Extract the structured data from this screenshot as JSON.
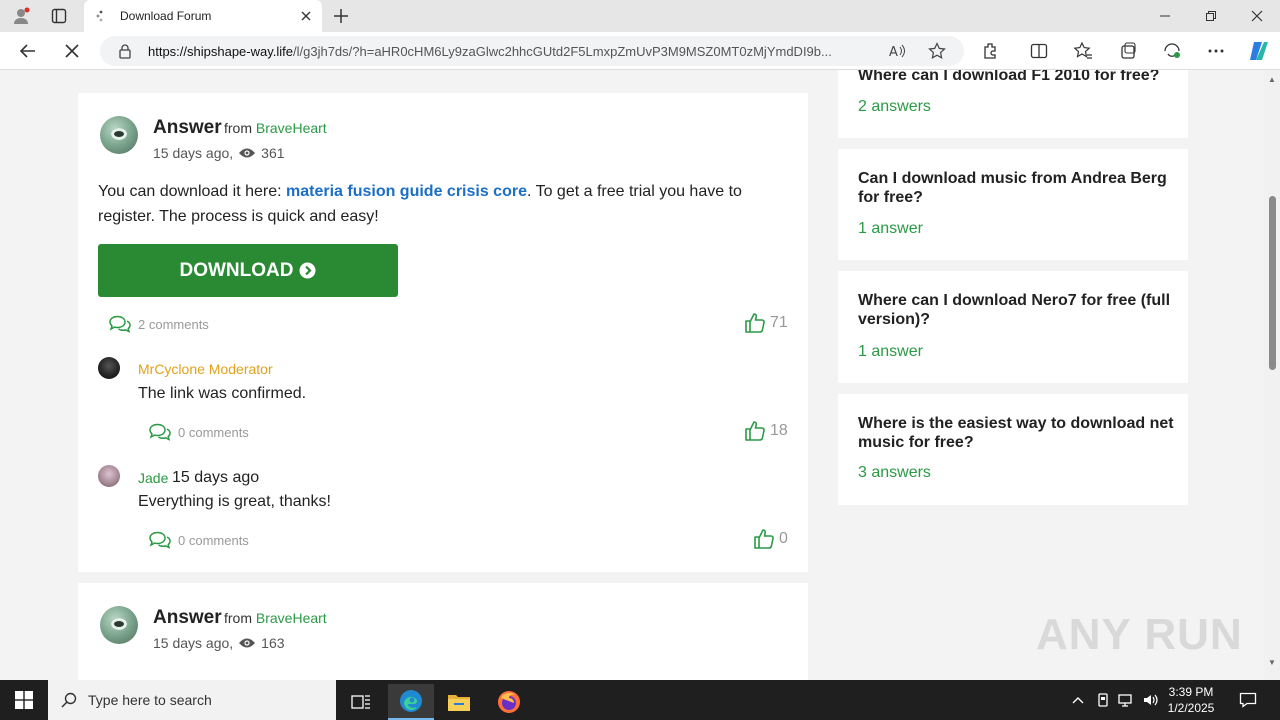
{
  "browser": {
    "tab_title": "Download Forum",
    "url_host": "https://shipshape-way.life",
    "url_path": "/l/g3jh7ds/?h=aHR0cHM6Ly9zaGlwc2hhcGUtd2F5LmxpZmUvP3M9MSZ0MT0zMjYmdDI9b..."
  },
  "main": {
    "answer1": {
      "label": "Answer",
      "from_word": "from",
      "author": "BraveHeart",
      "time": "15 days ago,",
      "views": "361",
      "text_before": "You can download it here: ",
      "link": "materia fusion guide crisis core",
      "text_after": ". To get a free trial you have to register. The process is quick and easy!",
      "download_label": "DOWNLOAD",
      "comments": "2 comments",
      "likes": "71"
    },
    "comment1": {
      "name": "MrCyclone Moderator",
      "text": "The link was confirmed.",
      "comments": "0 comments",
      "likes": "18"
    },
    "comment2": {
      "name": "Jade",
      "time": "15 days ago",
      "text": "Everything is great, thanks!",
      "comments": "0 comments",
      "likes": "0"
    },
    "answer2": {
      "label": "Answer",
      "from_word": "from",
      "author": "BraveHeart",
      "time": "15 days ago,",
      "views": "163"
    }
  },
  "sidebar": {
    "items": [
      {
        "question": "Where can I download F1 2010 for free?",
        "answers": "2 answers"
      },
      {
        "question": "Can I download music from Andrea Berg for free?",
        "answers": "1 answer"
      },
      {
        "question": "Where can I download Nero7 for free (full version)?",
        "answers": "1 answer"
      },
      {
        "question": "Where is the easiest way to download net music for free?",
        "answers": "3 answers"
      }
    ]
  },
  "watermark": "ANY RUN",
  "taskbar": {
    "search_placeholder": "Type here to search",
    "time": "3:39 PM",
    "date": "1/2/2025"
  },
  "colors": {
    "accent_green": "#2b9a46",
    "download_button": "#2a8a34",
    "link_blue": "#1b6fc4",
    "moderator": "#e0a21b"
  }
}
